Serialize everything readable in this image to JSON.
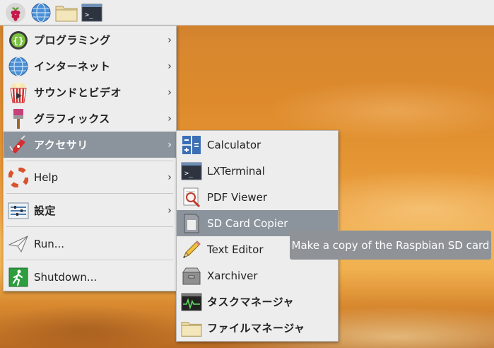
{
  "taskbar": {
    "icons": [
      "raspberry-icon",
      "globe-icon",
      "folder-icon",
      "terminal-icon"
    ]
  },
  "main_menu": {
    "items": [
      {
        "label": "プログラミング",
        "icon": "programming-icon"
      },
      {
        "label": "インターネット",
        "icon": "globe-icon"
      },
      {
        "label": "サウンドとビデオ",
        "icon": "popcorn-icon"
      },
      {
        "label": "グラフィックス",
        "icon": "paintbrush-icon"
      },
      {
        "label": "アクセサリ",
        "icon": "swiss-knife-icon"
      },
      {
        "label": "Help",
        "icon": "lifebuoy-icon"
      },
      {
        "label": "設定",
        "icon": "settings-icon"
      },
      {
        "label": "Run...",
        "icon": "paper-plane-icon"
      },
      {
        "label": "Shutdown...",
        "icon": "running-man-icon"
      }
    ],
    "submenu_arrow": "›"
  },
  "accessories_menu": {
    "items": [
      {
        "label": "Calculator",
        "icon": "calculator-icon"
      },
      {
        "label": "LXTerminal",
        "icon": "terminal-icon"
      },
      {
        "label": "PDF Viewer",
        "icon": "pdf-viewer-icon"
      },
      {
        "label": "SD Card Copier",
        "icon": "sd-card-icon"
      },
      {
        "label": "Text Editor",
        "icon": "pencil-icon"
      },
      {
        "label": "Xarchiver",
        "icon": "archive-icon"
      },
      {
        "label": "タスクマネージャ",
        "icon": "task-manager-icon"
      },
      {
        "label": "ファイルマネージャ",
        "icon": "folder-icon"
      }
    ]
  },
  "tooltip": {
    "text": "Make a copy of the Raspbian SD card"
  },
  "colors": {
    "menu_bg": "#ededed",
    "selection": "#8b949d",
    "taskbar": "#ededed"
  }
}
